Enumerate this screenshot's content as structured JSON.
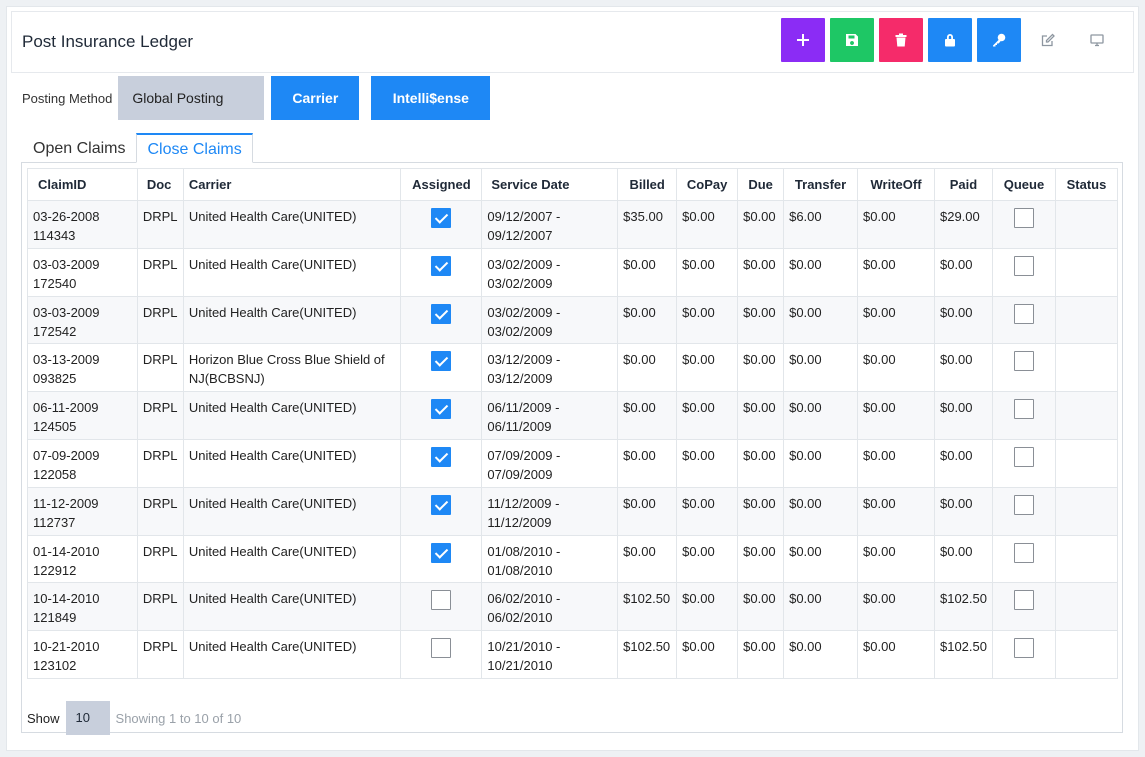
{
  "page": {
    "title": "Post Insurance Ledger"
  },
  "toolbar": [
    {
      "name": "add-button",
      "icon": "plus-icon",
      "color": "#8b2cf5"
    },
    {
      "name": "save-button",
      "icon": "save-icon",
      "color": "#1ec765"
    },
    {
      "name": "delete-button",
      "icon": "trash-icon",
      "color": "#f52b6a"
    },
    {
      "name": "lock-button",
      "icon": "lock-icon",
      "color": "#1e88f5"
    },
    {
      "name": "key-button",
      "icon": "key-icon",
      "color": "#1e88f5"
    },
    {
      "name": "edit-button",
      "icon": "edit-icon",
      "color": "transparent"
    },
    {
      "name": "monitor-button",
      "icon": "monitor-icon",
      "color": "transparent"
    }
  ],
  "posting": {
    "label": "Posting Method",
    "global_label": "Global Posting",
    "carrier_label": "Carrier",
    "intelli_label": "Intelli$ense"
  },
  "tabs": {
    "open": "Open Claims",
    "close": "Close Claims",
    "active": "close"
  },
  "table": {
    "columns": [
      "ClaimID",
      "Doc",
      "Carrier",
      "Assigned",
      "Service Date",
      "Billed",
      "CoPay",
      "Due",
      "Transfer",
      "WriteOff",
      "Paid",
      "Queue",
      "Status"
    ],
    "rows": [
      {
        "claim_date": "03-26-2008",
        "claim_no": "114343",
        "doc": "DRPL",
        "carrier": "United Health Care(UNITED)",
        "assigned": true,
        "svc_from": "09/12/2007 -",
        "svc_to": "09/12/2007",
        "billed": "$35.00",
        "copay": "$0.00",
        "due": "$0.00",
        "transfer": "$6.00",
        "writeoff": "$0.00",
        "paid": "$29.00",
        "queue": false,
        "status": ""
      },
      {
        "claim_date": "03-03-2009",
        "claim_no": "172540",
        "doc": "DRPL",
        "carrier": "United Health Care(UNITED)",
        "assigned": true,
        "svc_from": "03/02/2009 -",
        "svc_to": "03/02/2009",
        "billed": "$0.00",
        "copay": "$0.00",
        "due": "$0.00",
        "transfer": "$0.00",
        "writeoff": "$0.00",
        "paid": "$0.00",
        "queue": false,
        "status": ""
      },
      {
        "claim_date": "03-03-2009",
        "claim_no": "172542",
        "doc": "DRPL",
        "carrier": "United Health Care(UNITED)",
        "assigned": true,
        "svc_from": "03/02/2009 -",
        "svc_to": "03/02/2009",
        "billed": "$0.00",
        "copay": "$0.00",
        "due": "$0.00",
        "transfer": "$0.00",
        "writeoff": "$0.00",
        "paid": "$0.00",
        "queue": false,
        "status": ""
      },
      {
        "claim_date": "03-13-2009",
        "claim_no": "093825",
        "doc": "DRPL",
        "carrier": "Horizon Blue Cross Blue Shield of NJ(BCBSNJ)",
        "assigned": true,
        "svc_from": "03/12/2009 -",
        "svc_to": "03/12/2009",
        "billed": "$0.00",
        "copay": "$0.00",
        "due": "$0.00",
        "transfer": "$0.00",
        "writeoff": "$0.00",
        "paid": "$0.00",
        "queue": false,
        "status": ""
      },
      {
        "claim_date": "06-11-2009",
        "claim_no": "124505",
        "doc": "DRPL",
        "carrier": "United Health Care(UNITED)",
        "assigned": true,
        "svc_from": "06/11/2009 -",
        "svc_to": "06/11/2009",
        "billed": "$0.00",
        "copay": "$0.00",
        "due": "$0.00",
        "transfer": "$0.00",
        "writeoff": "$0.00",
        "paid": "$0.00",
        "queue": false,
        "status": ""
      },
      {
        "claim_date": "07-09-2009",
        "claim_no": "122058",
        "doc": "DRPL",
        "carrier": "United Health Care(UNITED)",
        "assigned": true,
        "svc_from": "07/09/2009 -",
        "svc_to": "07/09/2009",
        "billed": "$0.00",
        "copay": "$0.00",
        "due": "$0.00",
        "transfer": "$0.00",
        "writeoff": "$0.00",
        "paid": "$0.00",
        "queue": false,
        "status": ""
      },
      {
        "claim_date": "11-12-2009",
        "claim_no": "112737",
        "doc": "DRPL",
        "carrier": "United Health Care(UNITED)",
        "assigned": true,
        "svc_from": "11/12/2009 -",
        "svc_to": "11/12/2009",
        "billed": "$0.00",
        "copay": "$0.00",
        "due": "$0.00",
        "transfer": "$0.00",
        "writeoff": "$0.00",
        "paid": "$0.00",
        "queue": false,
        "status": ""
      },
      {
        "claim_date": "01-14-2010",
        "claim_no": "122912",
        "doc": "DRPL",
        "carrier": "United Health Care(UNITED)",
        "assigned": true,
        "svc_from": "01/08/2010 -",
        "svc_to": "01/08/2010",
        "billed": "$0.00",
        "copay": "$0.00",
        "due": "$0.00",
        "transfer": "$0.00",
        "writeoff": "$0.00",
        "paid": "$0.00",
        "queue": false,
        "status": ""
      },
      {
        "claim_date": "10-14-2010",
        "claim_no": "121849",
        "doc": "DRPL",
        "carrier": "United Health Care(UNITED)",
        "assigned": false,
        "svc_from": "06/02/2010 -",
        "svc_to": "06/02/2010",
        "billed": "$102.50",
        "copay": "$0.00",
        "due": "$0.00",
        "transfer": "$0.00",
        "writeoff": "$0.00",
        "paid": "$102.50",
        "queue": false,
        "status": ""
      },
      {
        "claim_date": "10-21-2010",
        "claim_no": "123102",
        "doc": "DRPL",
        "carrier": "United Health Care(UNITED)",
        "assigned": false,
        "svc_from": "10/21/2010 -",
        "svc_to": "10/21/2010",
        "billed": "$102.50",
        "copay": "$0.00",
        "due": "$0.00",
        "transfer": "$0.00",
        "writeoff": "$0.00",
        "paid": "$102.50",
        "queue": false,
        "status": ""
      }
    ]
  },
  "pager": {
    "show_label": "Show",
    "page_size": "10",
    "showing_text": "Showing 1 to 10 of 10"
  }
}
